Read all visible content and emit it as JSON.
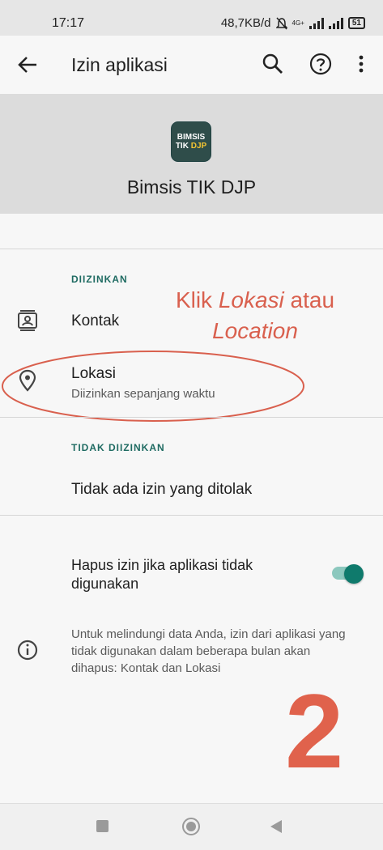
{
  "status_bar": {
    "time": "17:17",
    "speed": "48,7KB/d",
    "network": "4G+",
    "battery": "51"
  },
  "app_bar": {
    "title": "Izin aplikasi",
    "icons": [
      "back-arrow-icon",
      "search-icon",
      "help-icon",
      "more-vert-icon"
    ]
  },
  "app_header": {
    "icon_line1": "BIMSIS",
    "icon_line2a": "TIK",
    "icon_line2b": "DJP",
    "app_name": "Bimsis TIK DJP"
  },
  "allowed": {
    "label": "DIIZINKAN",
    "items": [
      {
        "title": "Kontak",
        "icon": "contacts-icon"
      },
      {
        "title": "Lokasi",
        "subtitle": "Diizinkan sepanjang waktu",
        "icon": "location-pin-icon"
      }
    ]
  },
  "denied": {
    "label": "TIDAK DIIZINKAN",
    "empty_text": "Tidak ada izin yang ditolak"
  },
  "remove_unused": {
    "label": "Hapus izin jika aplikasi tidak digunakan",
    "enabled": true,
    "info": "Untuk melindungi data Anda, izin dari aplikasi yang tidak digunakan dalam beberapa bulan akan dihapus: Kontak dan Lokasi"
  },
  "annotation": {
    "text_prefix": "Klik ",
    "text_italic1": "Lokasi",
    "text_mid": " atau",
    "text_italic2": "Location",
    "step_number": "2",
    "color": "#d9604e"
  },
  "colors": {
    "accent": "#0f7a6c",
    "section_label": "#1f6b62",
    "header_band": "#dcdcdc"
  }
}
